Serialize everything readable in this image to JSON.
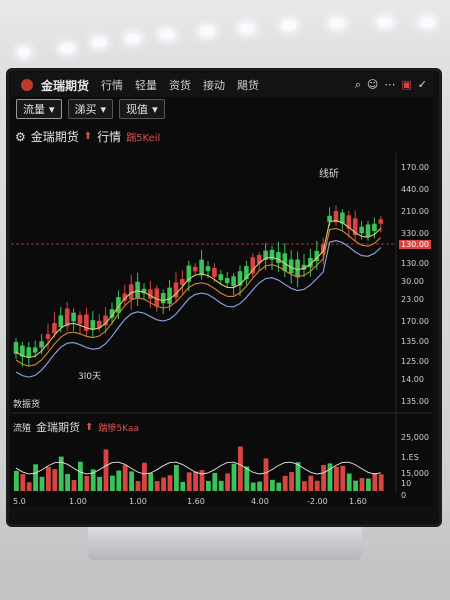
{
  "topbar": {
    "app_title": "金瑞期货",
    "nav": [
      "行情",
      "轻量",
      "资货",
      "接动",
      "飓货"
    ]
  },
  "toolbar": {
    "dropdowns": [
      "流量",
      "涕买",
      "现值"
    ]
  },
  "chart_header": {
    "title": "金瑞期货",
    "label": "行情",
    "tag": "踹5Keil"
  },
  "annotations": {
    "peak": "线斫",
    "trough": "3l0天",
    "section": "敦振货"
  },
  "price_axis": [
    "170.00",
    "440.00",
    "210.00",
    "330.00",
    "130.00",
    "130.00",
    "30.00",
    "23.00",
    "170.00",
    "135.00",
    "125.00",
    "14.00",
    "135.00"
  ],
  "current_price": "130.00",
  "volume_panel": {
    "label_left": "流殖",
    "title": "金瑞期货",
    "tag": "踹惨5Kaa",
    "axis": [
      "25,000",
      "1.ES",
      "15,000",
      "10",
      "0"
    ]
  },
  "time_axis": [
    "5.0",
    "1.00",
    "1.00",
    "1.60",
    "4.00",
    "-2.00",
    "1.60"
  ],
  "colors": {
    "up": "#3cc25a",
    "down": "#d64541",
    "ma_fast": "#d9cf6a",
    "ma_mid": "#d4892a",
    "ma_slow": "#8fa7e6",
    "last_price": "#d64541"
  }
}
